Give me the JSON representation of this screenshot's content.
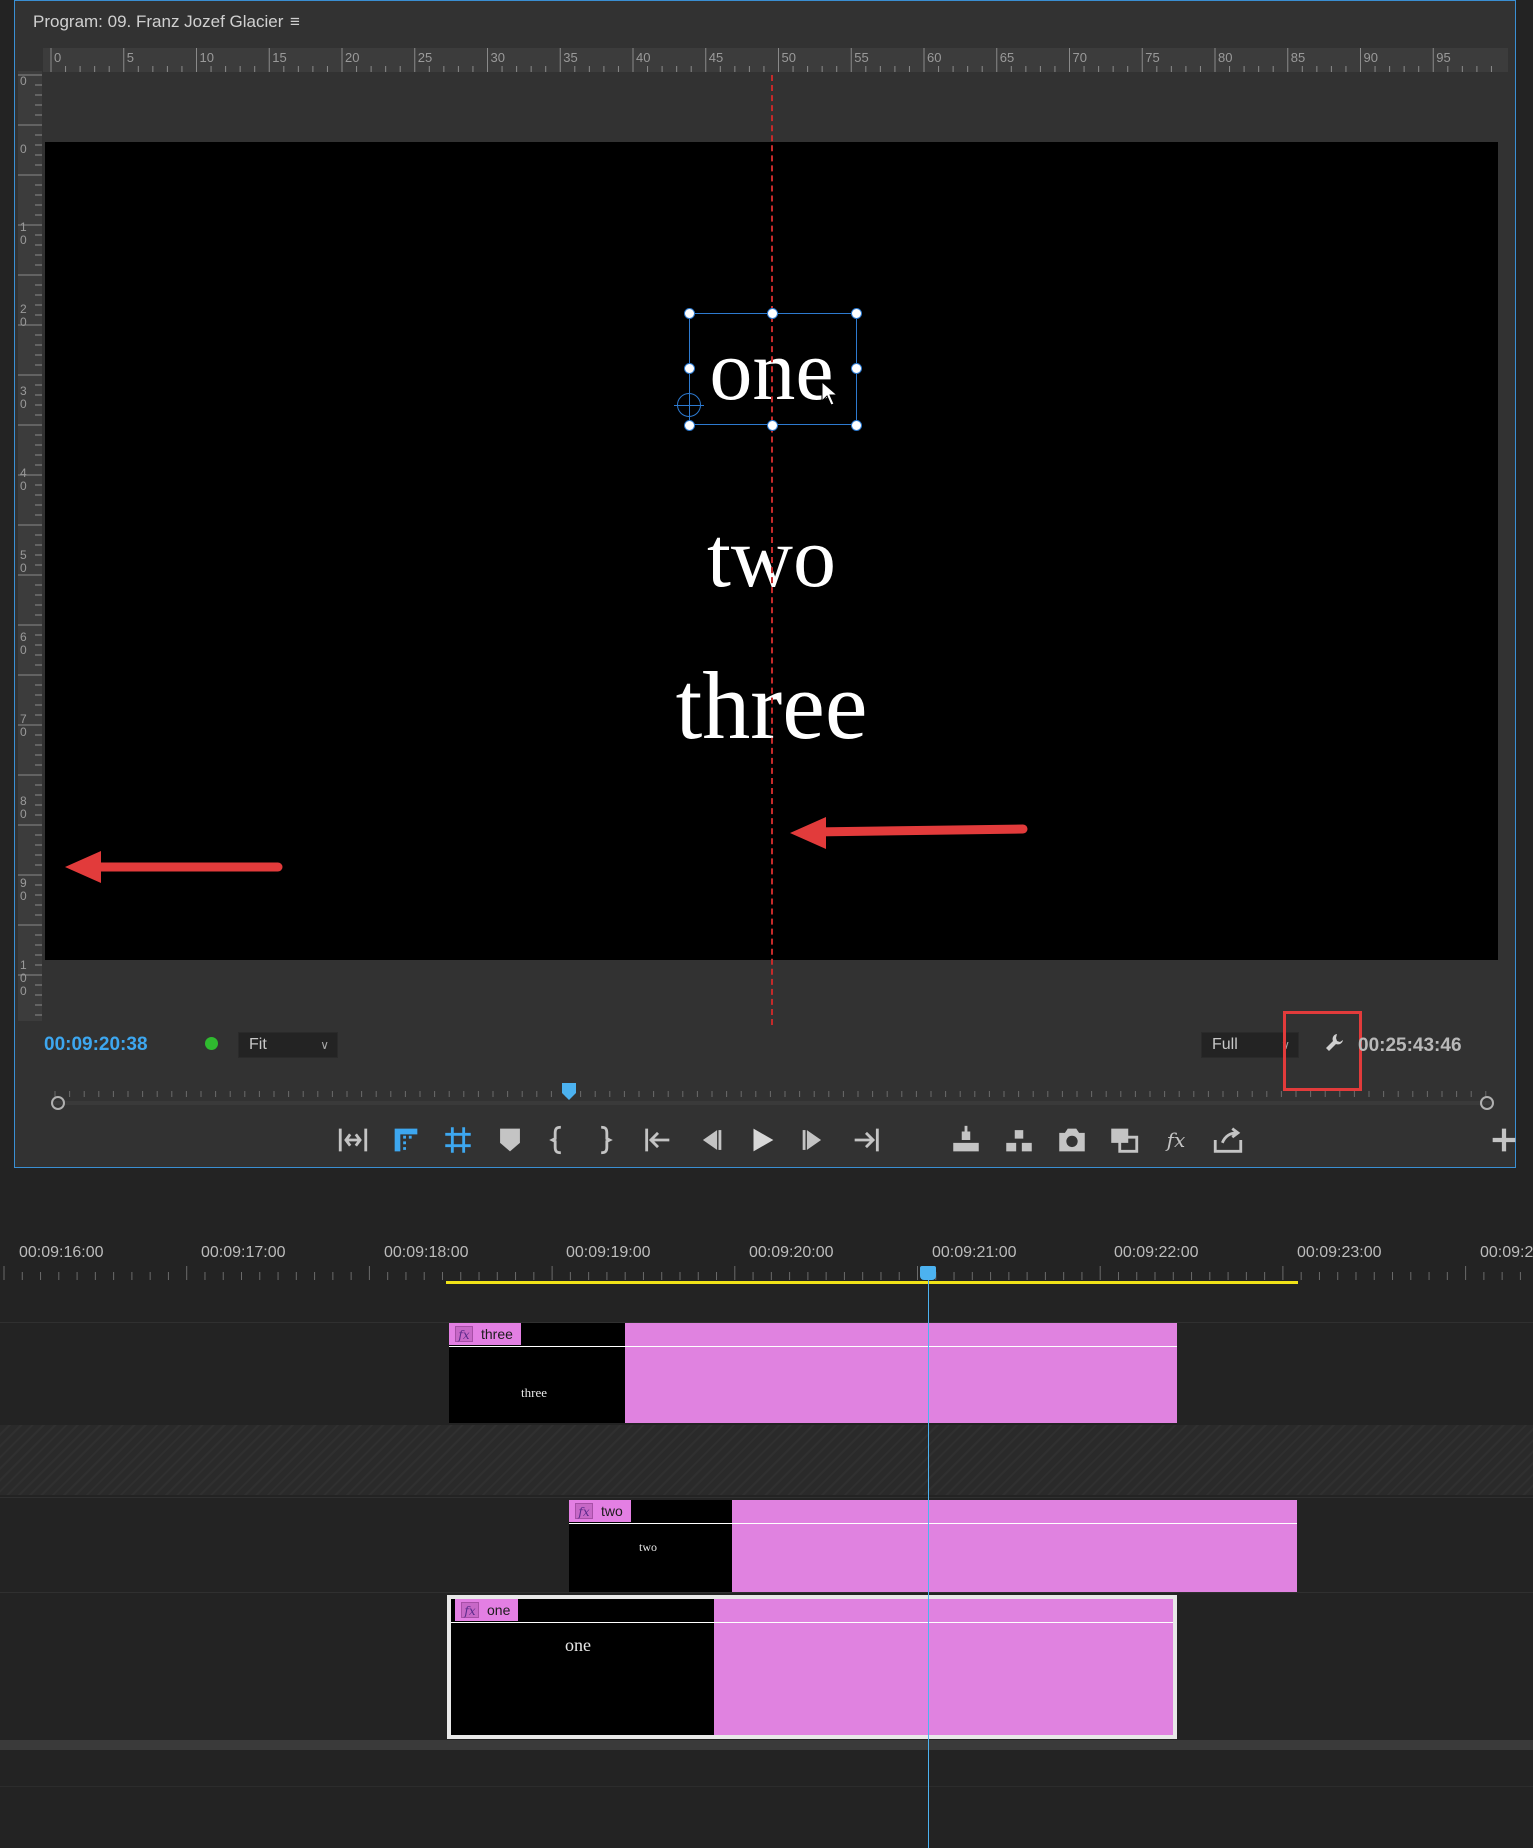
{
  "monitor": {
    "title": "Program: 09. Franz Jozef Glacier",
    "menu_icon": "hamburger-menu-icon",
    "ruler_h_labels": [
      "0",
      "5",
      "10",
      "15",
      "20",
      "25",
      "30",
      "35",
      "40",
      "45",
      "50",
      "55",
      "60",
      "65",
      "70",
      "75",
      "80",
      "85",
      "90",
      "95"
    ],
    "ruler_v_labels": [
      "0",
      "0",
      "10",
      "20",
      "30",
      "40",
      "50",
      "60",
      "70",
      "80",
      "90",
      "100"
    ],
    "titles": [
      "one",
      "two",
      "three"
    ],
    "current_timecode": "00:09:20:38",
    "zoom_select": "Fit",
    "resolution_select": "Full",
    "duration_timecode": "00:25:43:46",
    "settings_icon": "wrench-icon",
    "colors": {
      "accent": "#3da7f0",
      "guide": "#c52a2a",
      "highlight": "#e23b3b",
      "clip": "#e082e0"
    }
  },
  "transport": {
    "buttons": [
      "insert-edit-icon",
      "safe-margins-icon",
      "grid-icon",
      "add-marker-icon",
      "mark-in-icon",
      "mark-out-icon",
      "go-to-in-icon",
      "step-back-icon",
      "play-icon",
      "step-forward-icon",
      "go-to-out-icon",
      "lift-icon",
      "extract-icon",
      "export-frame-icon",
      "comparison-view-icon",
      "fx-icon",
      "export-icon",
      "add-button-icon"
    ]
  },
  "timeline": {
    "times": [
      "00:09:16:00",
      "00:09:17:00",
      "00:09:18:00",
      "00:09:19:00",
      "00:09:20:00",
      "00:09:21:00",
      "00:09:22:00",
      "00:09:23:00",
      "00:09:2"
    ],
    "clips": [
      {
        "name": "three",
        "thumb": "three"
      },
      {
        "name": "two",
        "thumb": "two"
      },
      {
        "name": "one",
        "thumb": "one"
      }
    ]
  }
}
